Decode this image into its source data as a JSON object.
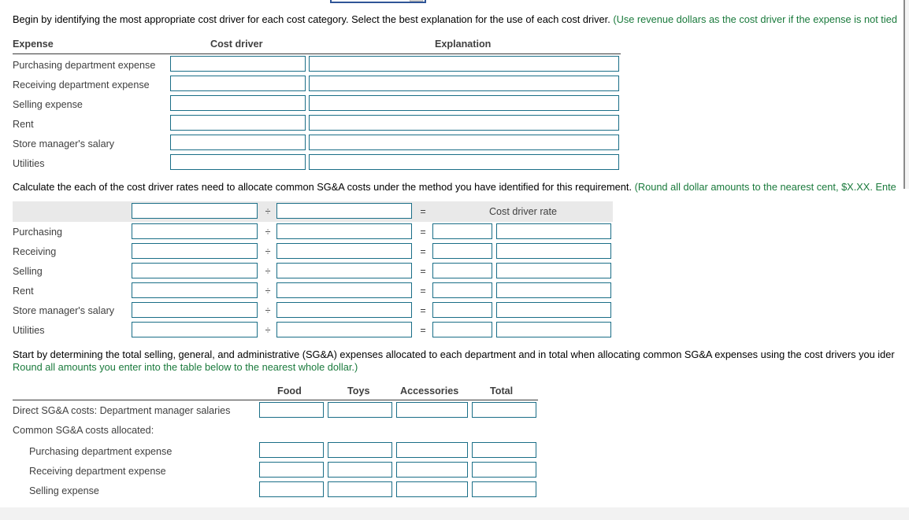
{
  "window": {
    "top_dropdown_value": "",
    "footer": ""
  },
  "section1": {
    "instruction_plain": "Begin by identifying the most appropriate cost driver for each cost category. Select the best explanation for the use of each cost driver. ",
    "instruction_green": "(Use revenue dollars as the cost driver if the expense is not tied",
    "headers": [
      "Expense",
      "Cost driver",
      "Explanation"
    ],
    "rows": [
      {
        "label": "Purchasing department expense",
        "cost_driver": "",
        "explanation": ""
      },
      {
        "label": "Receiving department expense",
        "cost_driver": "",
        "explanation": ""
      },
      {
        "label": "Selling expense",
        "cost_driver": "",
        "explanation": ""
      },
      {
        "label": "Rent",
        "cost_driver": "",
        "explanation": ""
      },
      {
        "label": "Store manager's salary",
        "cost_driver": "",
        "explanation": ""
      },
      {
        "label": "Utilities",
        "cost_driver": "",
        "explanation": ""
      }
    ]
  },
  "section2": {
    "instruction_plain": "Calculate the each of the cost driver rates need to allocate common SG&A costs under the method you have identified for this requirement. ",
    "instruction_green": "(Round all dollar amounts to the nearest cent, $X.XX. Ente",
    "header_row": {
      "label": "",
      "numerator": "",
      "operator1": "÷",
      "denominator": "",
      "operator2": "=",
      "result_label": "Cost driver rate"
    },
    "operators": {
      "divide": "÷",
      "equals": "="
    },
    "rows": [
      {
        "label": "Purchasing",
        "numerator": "",
        "denominator": "",
        "result_a": "",
        "result_b": ""
      },
      {
        "label": "Receiving",
        "numerator": "",
        "denominator": "",
        "result_a": "",
        "result_b": ""
      },
      {
        "label": "Selling",
        "numerator": "",
        "denominator": "",
        "result_a": "",
        "result_b": ""
      },
      {
        "label": "Rent",
        "numerator": "",
        "denominator": "",
        "result_a": "",
        "result_b": ""
      },
      {
        "label": "Store manager's salary",
        "numerator": "",
        "denominator": "",
        "result_a": "",
        "result_b": ""
      },
      {
        "label": "Utilities",
        "numerator": "",
        "denominator": "",
        "result_a": "",
        "result_b": ""
      }
    ]
  },
  "section3": {
    "instruction_plain_1": "Start by determining the total selling, general, and administrative (SG&A) expenses allocated to each department and in total when allocating common SG&A expenses using the cost drivers you ider",
    "instruction_green_2": "Round all amounts you enter into the table below to the nearest whole dollar.)",
    "headers": [
      "Food",
      "Toys",
      "Accessories",
      "Total"
    ],
    "rows": [
      {
        "label": "Direct SG&A costs: Department manager salaries",
        "has_inputs": true,
        "indent": false,
        "values": [
          "",
          "",
          "",
          ""
        ]
      },
      {
        "label": "Common SG&A costs allocated:",
        "has_inputs": false,
        "indent": false,
        "values": []
      },
      {
        "label": "Purchasing department expense",
        "has_inputs": true,
        "indent": true,
        "values": [
          "",
          "",
          "",
          ""
        ]
      },
      {
        "label": "Receiving department expense",
        "has_inputs": true,
        "indent": true,
        "values": [
          "",
          "",
          "",
          ""
        ]
      },
      {
        "label": "Selling expense",
        "has_inputs": true,
        "indent": true,
        "values": [
          "",
          "",
          "",
          ""
        ]
      }
    ]
  },
  "colors": {
    "input_border": "#1a6e87",
    "green_text": "#1a7a3c",
    "gray_band": "#e9e9e9"
  }
}
